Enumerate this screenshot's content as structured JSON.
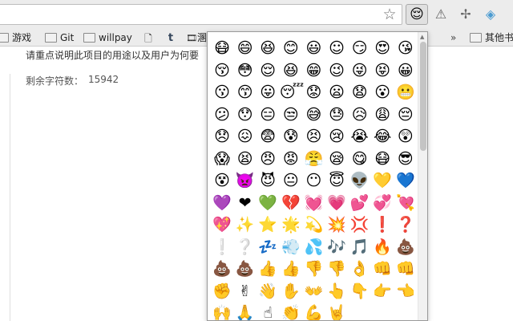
{
  "toolbar": {
    "star_icon": "star-icon",
    "extension_icon": "😌",
    "other_icons": [
      "⚠",
      "✢",
      "◈"
    ]
  },
  "bookmarks": {
    "items": [
      {
        "label": "游戏",
        "icon": "folder-icon"
      },
      {
        "label": "Git",
        "icon": "folder-icon"
      },
      {
        "label": "willpay",
        "icon": "folder-icon"
      },
      {
        "label": "",
        "icon": "document-icon"
      },
      {
        "label": "",
        "icon": "tumblr-icon"
      },
      {
        "label": "溷",
        "icon": "film-icon"
      }
    ],
    "overflow": "»",
    "other_folder": "其他书"
  },
  "content": {
    "hint": "请重点说明此项目的用途以及用户为何要",
    "counter_label": "剩余字符数：",
    "counter_value": "15942"
  },
  "emoji_picker": {
    "rows": [
      [
        "😷",
        "😄",
        "😆",
        "😊",
        "😃",
        "☺",
        "😏",
        "😍",
        "😘"
      ],
      [
        "😚",
        "😳",
        "😌",
        "😆",
        "😁",
        "😉",
        "😜",
        "😝",
        "😀"
      ],
      [
        "😗",
        "😙",
        "😛",
        "😴",
        "😟",
        "😦",
        "😧",
        "😮",
        "😬"
      ],
      [
        "😕",
        "😯",
        "😑",
        "😒",
        "😅",
        "😓",
        "😥",
        "😩",
        "😔"
      ],
      [
        "😞",
        "😖",
        "😨",
        "😰",
        "😣",
        "😢",
        "😭",
        "😂",
        "😲"
      ],
      [
        "😱",
        "😫",
        "😠",
        "😡",
        "😤",
        "😪",
        "😋",
        "😷",
        "😎"
      ],
      [
        "😵",
        "👿",
        "😈",
        "😐",
        "😶",
        "😇",
        "👽",
        "💛",
        "💙"
      ],
      [
        "💜",
        "❤",
        "💚",
        "💔",
        "💓",
        "💗",
        "💕",
        "💞",
        "💘"
      ],
      [
        "💖",
        "✨",
        "⭐",
        "🌟",
        "💫",
        "💥",
        "💢",
        "❗",
        "❓"
      ],
      [
        "❕",
        "❔",
        "💤",
        "💨",
        "💦",
        "🎶",
        "🎵",
        "🔥",
        "💩"
      ],
      [
        "💩",
        "💩",
        "👍",
        "👍",
        "👎",
        "👎",
        "👌",
        "👊",
        "👊"
      ],
      [
        "✊",
        "✌",
        "👋",
        "✋",
        "👐",
        "👆",
        "👇",
        "👉",
        "👈"
      ],
      [
        "🙌",
        "🙏",
        "☝",
        "👏",
        "💪",
        "🤘",
        "",
        "",
        ""
      ]
    ]
  }
}
